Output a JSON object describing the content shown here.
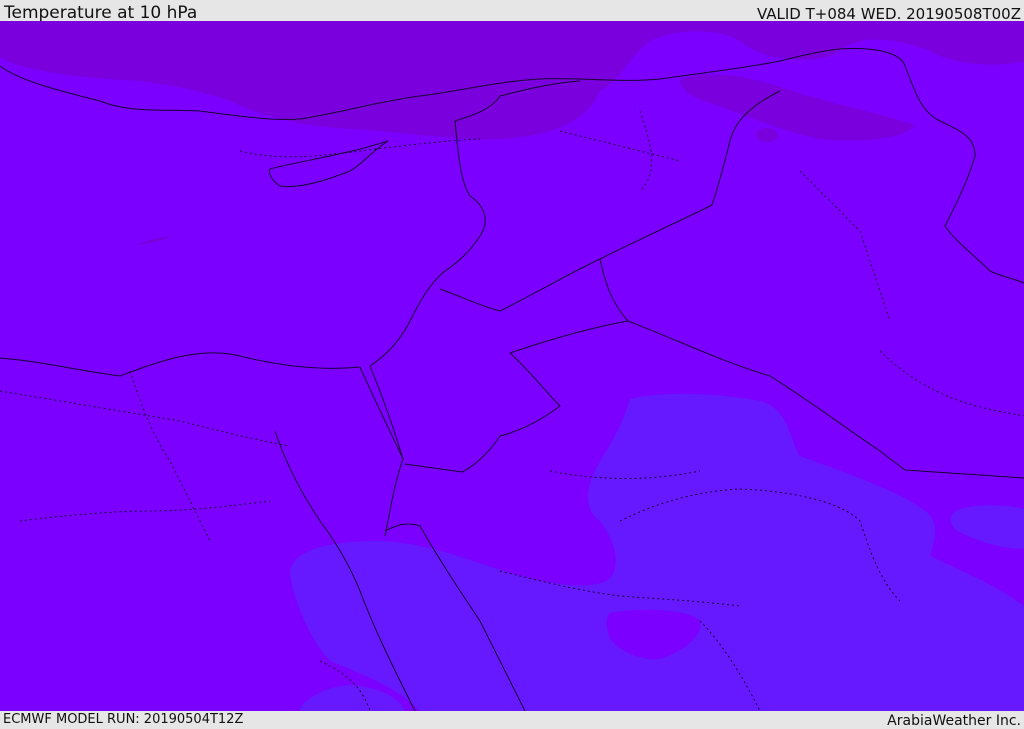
{
  "header": {
    "title": "Temperature at 10 hPa",
    "valid": "VALID T+084 WED. 20190508T00Z"
  },
  "footer": {
    "model_run": "ECMWF MODEL RUN: 20190504T12Z",
    "brand": "ArabiaWeather Inc."
  },
  "colors": {
    "field_main": "#7b00ff",
    "field_cold_north": "#7a00de",
    "field_warm_south": "#6619ff",
    "boundary": "#1a0033"
  }
}
